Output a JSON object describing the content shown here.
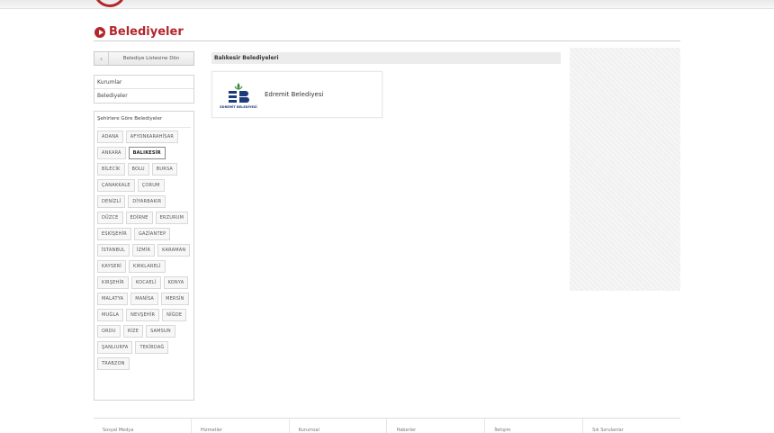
{
  "header": {
    "title": "Belediyeler"
  },
  "sidebar": {
    "back_label": "Belediye Listesine Dön",
    "menu": [
      {
        "label": "Kurumlar"
      },
      {
        "label": "Belediyeler"
      }
    ],
    "cities_caption": "Şehirlere Göre Belediyeler",
    "cities": [
      {
        "label": "ADANA"
      },
      {
        "label": "AFYONKARAHİSAR"
      },
      {
        "label": "ANKARA"
      },
      {
        "label": "BALIKESİR",
        "active": true
      },
      {
        "label": "BİLECİK"
      },
      {
        "label": "BOLU"
      },
      {
        "label": "BURSA"
      },
      {
        "label": "ÇANAKKALE"
      },
      {
        "label": "ÇORUM"
      },
      {
        "label": "DENİZLİ"
      },
      {
        "label": "DİYARBAKIR"
      },
      {
        "label": "DÜZCE"
      },
      {
        "label": "EDİRNE"
      },
      {
        "label": "ERZURUM"
      },
      {
        "label": "ESKİŞEHİR"
      },
      {
        "label": "GAZİANTEP"
      },
      {
        "label": "İSTANBUL"
      },
      {
        "label": "İZMİR"
      },
      {
        "label": "KARAMAN"
      },
      {
        "label": "KAYSERİ"
      },
      {
        "label": "KIRKLARELİ"
      },
      {
        "label": "KIRŞEHİR"
      },
      {
        "label": "KOCAELİ"
      },
      {
        "label": "KONYA"
      },
      {
        "label": "MALATYA"
      },
      {
        "label": "MANİSA"
      },
      {
        "label": "MERSİN"
      },
      {
        "label": "MUĞLA"
      },
      {
        "label": "NEVŞEHİR"
      },
      {
        "label": "NİĞDE"
      },
      {
        "label": "ORDU"
      },
      {
        "label": "RİZE"
      },
      {
        "label": "SAMSUN"
      },
      {
        "label": "ŞANLIURFA"
      },
      {
        "label": "TEKİRDAĞ"
      },
      {
        "label": "TRABZON"
      }
    ]
  },
  "main": {
    "section_title": "Balıkesir Belediyeleri",
    "cards": [
      {
        "name": "Edremit Belediyesi",
        "logo_caption": "EDREMİT BELEDİYESİ",
        "logo_icon": "edremit-logo"
      }
    ]
  },
  "footer": {
    "items": [
      {
        "label": "Sosyal Medya"
      },
      {
        "label": "Hizmetler"
      },
      {
        "label": "Kurumsal"
      },
      {
        "label": "Haberler"
      },
      {
        "label": "İletişim"
      },
      {
        "label": "Sık Sorulanlar"
      }
    ]
  },
  "colors": {
    "accent": "#b3262b",
    "logo_blue": "#1b3b7a",
    "logo_green": "#3a8a3a"
  }
}
